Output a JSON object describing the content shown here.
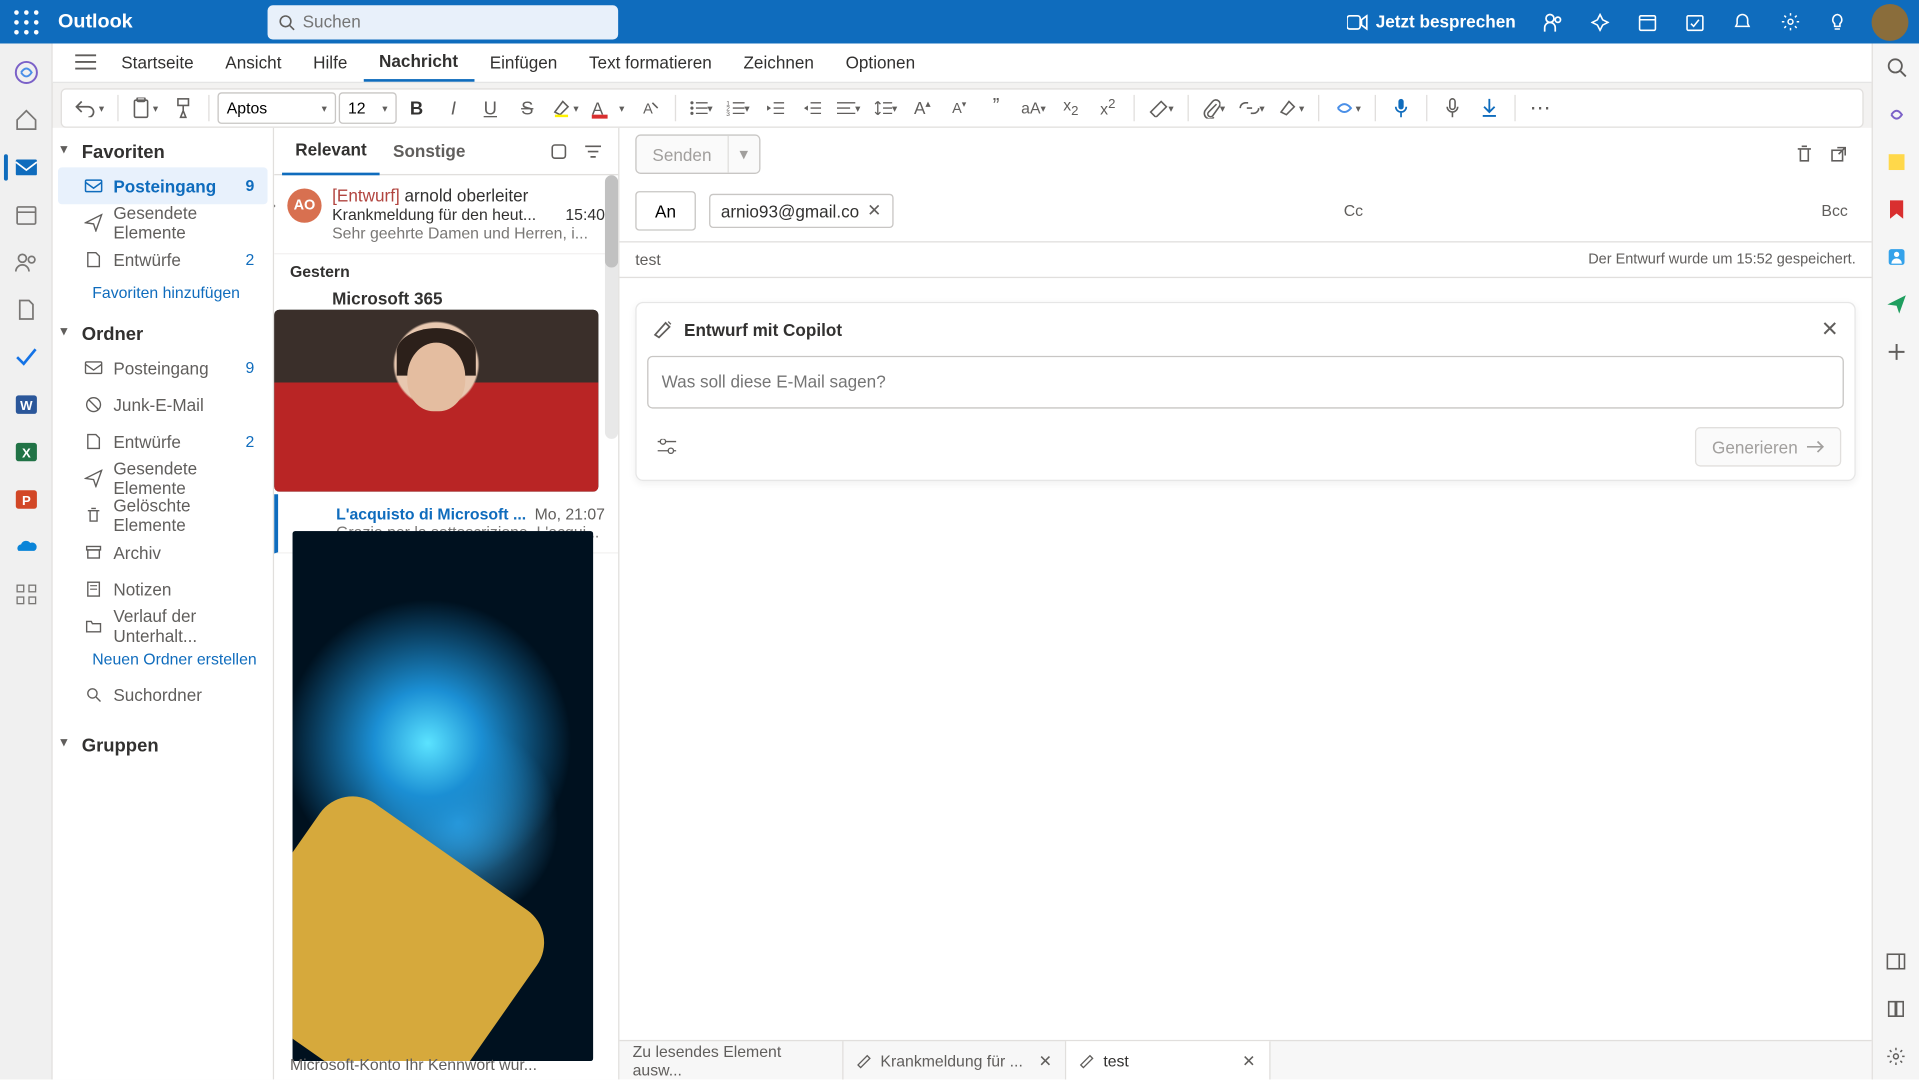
{
  "app": {
    "name": "Outlook",
    "search_placeholder": "Suchen",
    "meet_now": "Jetzt besprechen"
  },
  "tabs": {
    "start": "Startseite",
    "view": "Ansicht",
    "help": "Hilfe",
    "message": "Nachricht",
    "insert": "Einfügen",
    "format": "Text formatieren",
    "draw": "Zeichnen",
    "options": "Optionen"
  },
  "ribbon": {
    "font": "Aptos",
    "size": "12"
  },
  "folders": {
    "fav_header": "Favoriten",
    "fav": [
      {
        "icon": "inbox",
        "label": "Posteingang",
        "badge": "9",
        "active": true
      },
      {
        "icon": "sent",
        "label": "Gesendete Elemente"
      },
      {
        "icon": "drafts",
        "label": "Entwürfe",
        "badge": "2"
      }
    ],
    "fav_add": "Favoriten hinzufügen",
    "ord_header": "Ordner",
    "ord": [
      {
        "icon": "inbox",
        "label": "Posteingang",
        "badge": "9"
      },
      {
        "icon": "junk",
        "label": "Junk-E-Mail"
      },
      {
        "icon": "drafts",
        "label": "Entwürfe",
        "badge": "2"
      },
      {
        "icon": "sent",
        "label": "Gesendete Elemente"
      },
      {
        "icon": "trash",
        "label": "Gelöschte Elemente"
      },
      {
        "icon": "archive",
        "label": "Archiv"
      },
      {
        "icon": "notes",
        "label": "Notizen"
      },
      {
        "icon": "folder",
        "label": "Verlauf der Unterhalt..."
      }
    ],
    "new_folder": "Neuen Ordner erstellen",
    "search_folder": "Suchordner",
    "groups": "Gruppen"
  },
  "mlist": {
    "tab_relevant": "Relevant",
    "tab_other": "Sonstige",
    "item1": {
      "avatar": "AO",
      "tag": "[Entwurf]",
      "from": "arnold oberleiter",
      "subject": "Krankmeldung für den heut...",
      "time": "15:40",
      "preview": "Sehr geehrte Damen und Herren, i..."
    },
    "group_yesterday": "Gestern",
    "item2_from": "Microsoft 365",
    "item3": {
      "subject": "L'acquisto di Microsoft ...",
      "time": "Mo, 21:07",
      "preview": "Grazie per la sottoscrizione. L'acqui..."
    },
    "bottom": "Microsoft-Konto Ihr Kennwort wur..."
  },
  "compose": {
    "send": "Senden",
    "to_label": "An",
    "recipient": "arnio93@gmail.co",
    "cc": "Cc",
    "bcc": "Bcc",
    "subject": "test",
    "saved": "Der Entwurf wurde um 15:52 gespeichert."
  },
  "copilot": {
    "title": "Entwurf mit Copilot",
    "placeholder": "Was soll diese E-Mail sagen?",
    "generate": "Generieren"
  },
  "bottom_tabs": {
    "t1": "Zu lesendes Element ausw...",
    "t2": "Krankmeldung für ...",
    "t3": "test"
  }
}
